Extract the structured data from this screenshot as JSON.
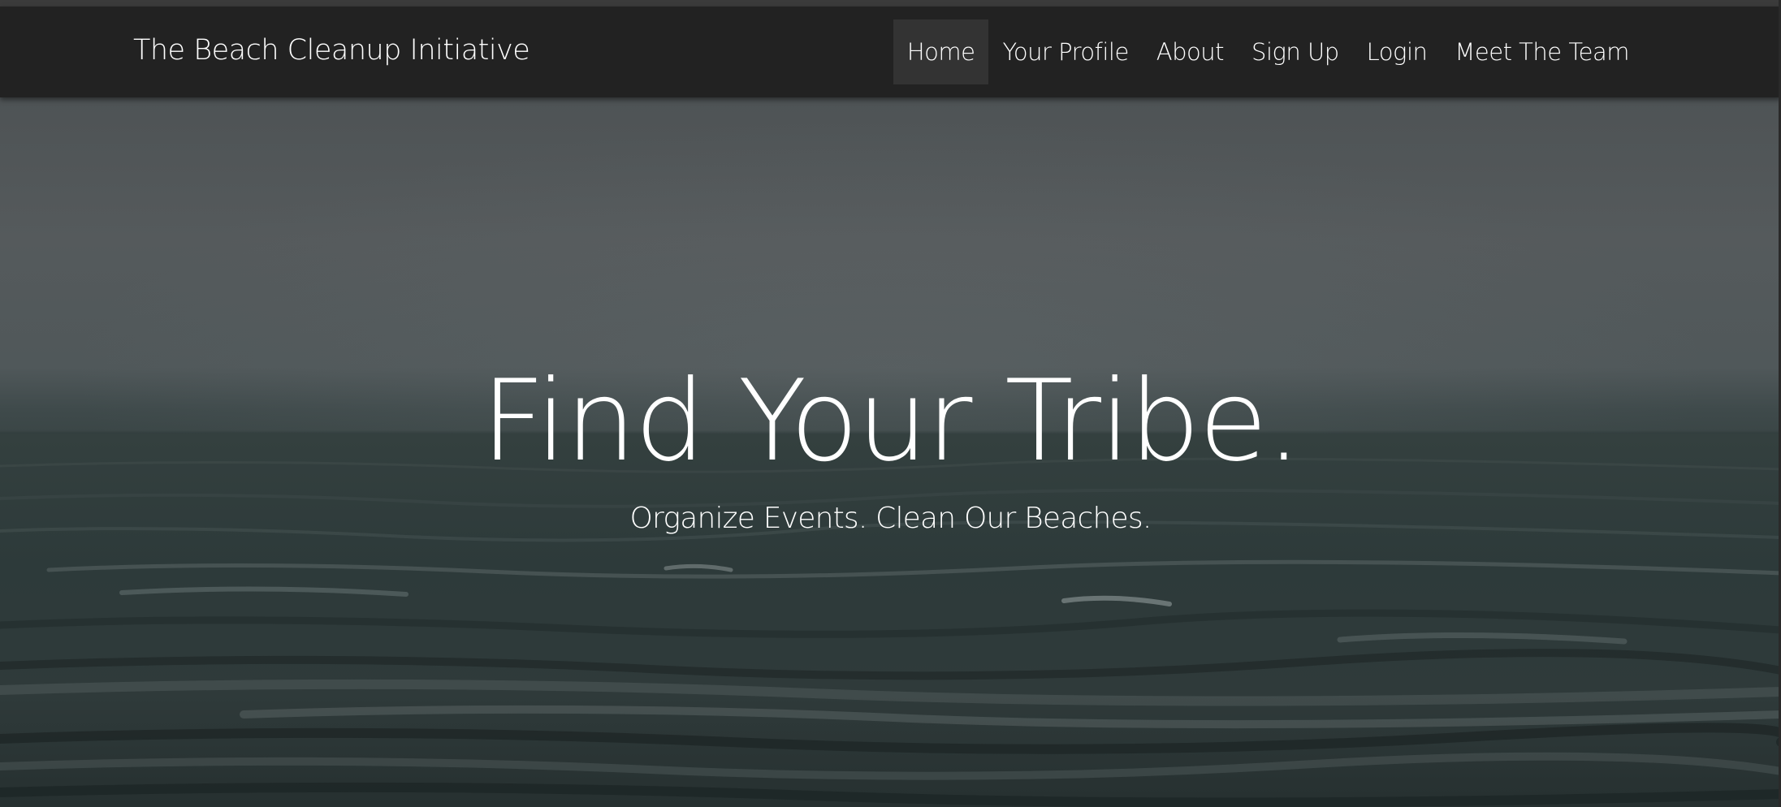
{
  "navbar": {
    "brand": "The Beach Cleanup Initiative",
    "items": [
      {
        "label": "Home",
        "active": true
      },
      {
        "label": "Your Profile",
        "active": false
      },
      {
        "label": "About",
        "active": false
      },
      {
        "label": "Sign Up",
        "active": false
      },
      {
        "label": "Login",
        "active": false
      },
      {
        "label": "Meet The Team",
        "active": false
      }
    ]
  },
  "hero": {
    "title": "Find Your Tribe.",
    "subtitle": "Organize Events. Clean Our Beaches.",
    "background_image": "ocean-waves-overcast"
  },
  "colors": {
    "navbar_bg": "#222222",
    "nav_active_bg": "#333333",
    "text": "#ffffff"
  }
}
